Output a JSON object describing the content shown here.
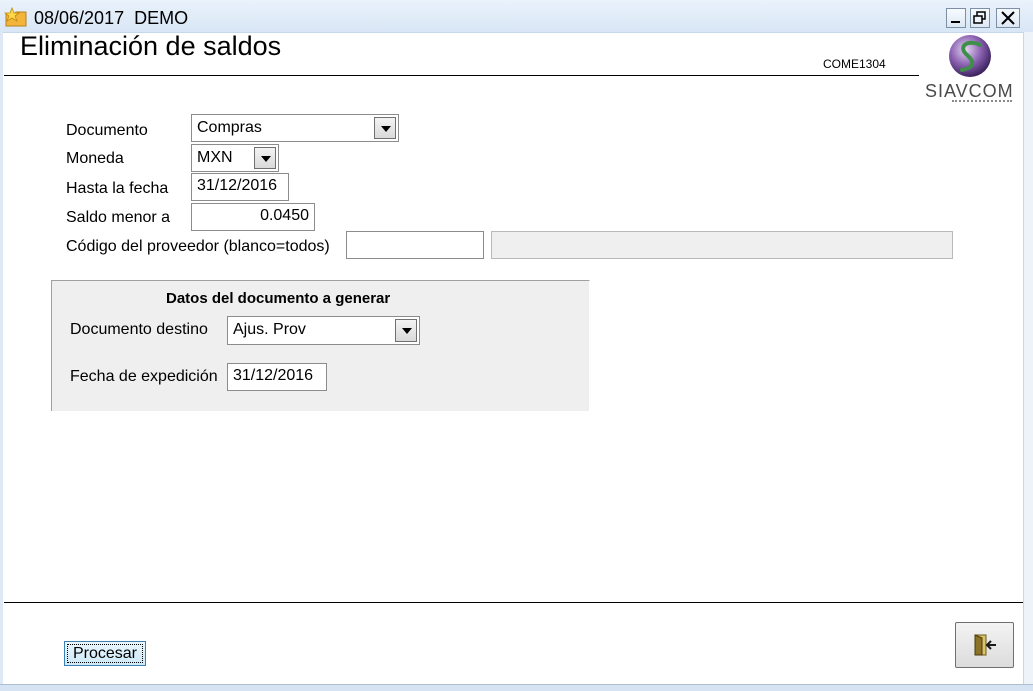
{
  "window": {
    "title": "08/06/2017  DEMO"
  },
  "header": {
    "page_title": "Eliminación de saldos",
    "form_code": "COME1304",
    "logo_text": "SIAVCOM"
  },
  "form": {
    "documento": {
      "label": "Documento",
      "value": "Compras"
    },
    "moneda": {
      "label": "Moneda",
      "value": "MXN"
    },
    "hasta_fecha": {
      "label": "Hasta la fecha",
      "value": "31/12/2016"
    },
    "saldo_menor": {
      "label": "Saldo  menor a",
      "value": "0.0450"
    },
    "proveedor": {
      "label": "Código del proveedor (blanco=todos)",
      "value": "",
      "name_value": ""
    }
  },
  "group": {
    "title": "Datos del documento a generar",
    "documento_destino": {
      "label": "Documento destino",
      "value": "Ajus. Prov"
    },
    "fecha_expedicion": {
      "label": "Fecha de expedición",
      "value": "31/12/2016"
    }
  },
  "footer": {
    "process_label": "Procesar"
  },
  "icons": {
    "app": "folder-star-icon",
    "exit": "exit-door-icon",
    "dropdown": "chevron-down-icon"
  },
  "colors": {
    "titlebar": "#dce8f6",
    "groupbox": "#efefef",
    "logo_green": "#3f8f4a",
    "logo_purple": "#6a3f8e"
  }
}
